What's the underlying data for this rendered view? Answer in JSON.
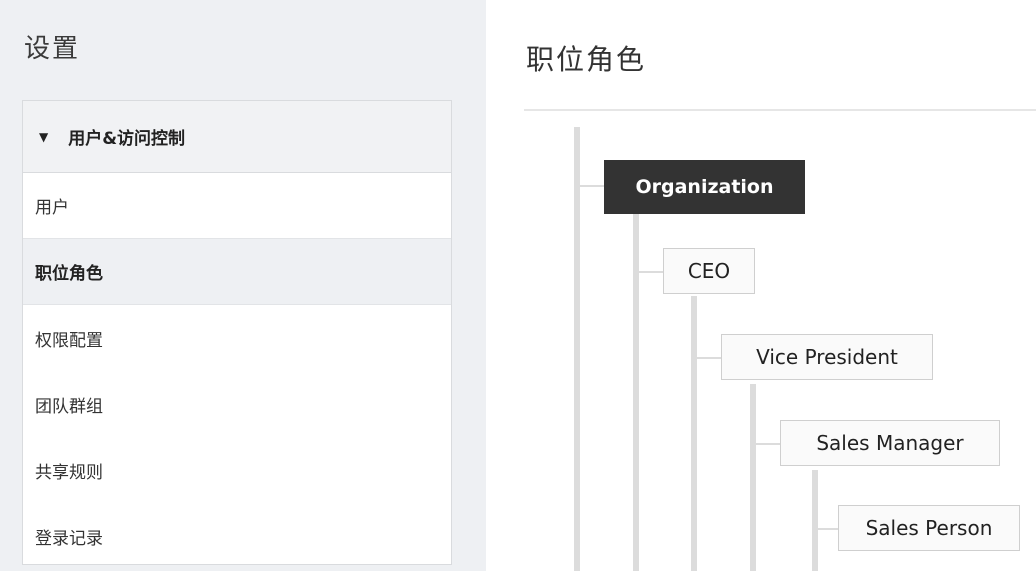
{
  "sidebar": {
    "title": "设置",
    "section": {
      "label": "用户&访问控制",
      "caret": "▼"
    },
    "items": [
      {
        "label": "用户"
      },
      {
        "label": "职位角色"
      },
      {
        "label": "权限配置"
      },
      {
        "label": "团队群组"
      },
      {
        "label": "共享规则"
      },
      {
        "label": "登录记录"
      }
    ],
    "active_item": "职位角色"
  },
  "main": {
    "title": "职位角色",
    "hierarchy": [
      {
        "label": "Organization",
        "level": 0
      },
      {
        "label": "CEO",
        "level": 1
      },
      {
        "label": "Vice President",
        "level": 2
      },
      {
        "label": "Sales Manager",
        "level": 3
      },
      {
        "label": "Sales Person",
        "level": 4
      }
    ]
  }
}
